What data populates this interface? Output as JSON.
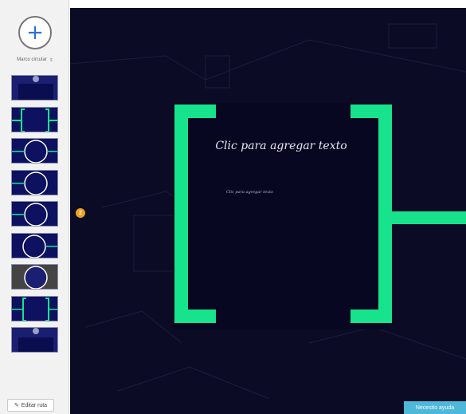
{
  "sidebar": {
    "add_label": "+",
    "layout_select": {
      "value": "Marco circular",
      "arrows": "⇕"
    },
    "thumbnails": [
      {
        "kind": "dark"
      },
      {
        "kind": "bracket-frame"
      },
      {
        "kind": "circle"
      },
      {
        "kind": "circle"
      },
      {
        "kind": "circle"
      },
      {
        "kind": "circle"
      },
      {
        "kind": "circle-gray"
      },
      {
        "kind": "bracket-frame"
      },
      {
        "kind": "dark"
      }
    ],
    "edit_path": {
      "icon": "pencil-icon",
      "label": "Editar ruta"
    }
  },
  "canvas": {
    "title_placeholder": "Clic para agregar texto",
    "body_placeholder": "Clic para agregar texto",
    "step_number": "2",
    "help_button": "Necesito ayuda"
  },
  "colors": {
    "accent": "#17e38c",
    "canvas_bg": "#0c0b26",
    "thumb_bg": "#0d1160",
    "badge": "#f0a020",
    "help": "#4db8d8"
  }
}
